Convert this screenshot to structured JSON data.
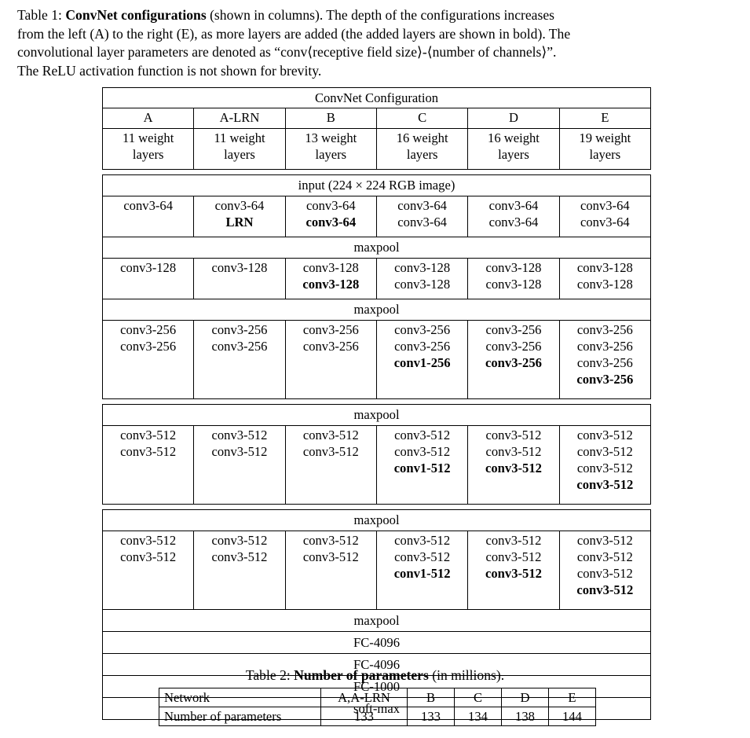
{
  "table1": {
    "caption_lines": [
      {
        "pre": "Table 1: ",
        "bold": "ConvNet configurations",
        "post": " (shown in columns).  The depth of the configurations increases"
      },
      {
        "pre": "",
        "bold": "",
        "post": "from the left (A) to the right (E), as more layers are added (the added layers are shown in bold). The"
      },
      {
        "pre": "",
        "bold": "",
        "post": "convolutional layer parameters are denoted as “conv⟨receptive field size⟩-⟨number of channels⟩”."
      },
      {
        "pre": "",
        "bold": "",
        "post": "The ReLU activation function is not shown for brevity."
      }
    ],
    "title_row": "ConvNet Configuration",
    "config_names": [
      "A",
      "A-LRN",
      "B",
      "C",
      "D",
      "E"
    ],
    "depths": [
      [
        "11 weight",
        "layers"
      ],
      [
        "11 weight",
        "layers"
      ],
      [
        "13 weight",
        "layers"
      ],
      [
        "16 weight",
        "layers"
      ],
      [
        "16 weight",
        "layers"
      ],
      [
        "19 weight",
        "layers"
      ]
    ],
    "input_row": "input (224 × 224 RGB image)",
    "maxpool": "maxpool",
    "block64": [
      [
        {
          "t": "conv3-64",
          "b": false
        }
      ],
      [
        {
          "t": "conv3-64",
          "b": false
        },
        {
          "t": "LRN",
          "b": true
        }
      ],
      [
        {
          "t": "conv3-64",
          "b": false
        },
        {
          "t": "conv3-64",
          "b": true
        }
      ],
      [
        {
          "t": "conv3-64",
          "b": false
        },
        {
          "t": "conv3-64",
          "b": false
        }
      ],
      [
        {
          "t": "conv3-64",
          "b": false
        },
        {
          "t": "conv3-64",
          "b": false
        }
      ],
      [
        {
          "t": "conv3-64",
          "b": false
        },
        {
          "t": "conv3-64",
          "b": false
        }
      ]
    ],
    "block128": [
      [
        {
          "t": "conv3-128",
          "b": false
        }
      ],
      [
        {
          "t": "conv3-128",
          "b": false
        }
      ],
      [
        {
          "t": "conv3-128",
          "b": false
        },
        {
          "t": "conv3-128",
          "b": true
        }
      ],
      [
        {
          "t": "conv3-128",
          "b": false
        },
        {
          "t": "conv3-128",
          "b": false
        }
      ],
      [
        {
          "t": "conv3-128",
          "b": false
        },
        {
          "t": "conv3-128",
          "b": false
        }
      ],
      [
        {
          "t": "conv3-128",
          "b": false
        },
        {
          "t": "conv3-128",
          "b": false
        }
      ]
    ],
    "block256": [
      [
        {
          "t": "conv3-256",
          "b": false
        },
        {
          "t": "conv3-256",
          "b": false
        }
      ],
      [
        {
          "t": "conv3-256",
          "b": false
        },
        {
          "t": "conv3-256",
          "b": false
        }
      ],
      [
        {
          "t": "conv3-256",
          "b": false
        },
        {
          "t": "conv3-256",
          "b": false
        }
      ],
      [
        {
          "t": "conv3-256",
          "b": false
        },
        {
          "t": "conv3-256",
          "b": false
        },
        {
          "t": "conv1-256",
          "b": true
        }
      ],
      [
        {
          "t": "conv3-256",
          "b": false
        },
        {
          "t": "conv3-256",
          "b": false
        },
        {
          "t": "conv3-256",
          "b": true
        }
      ],
      [
        {
          "t": "conv3-256",
          "b": false
        },
        {
          "t": "conv3-256",
          "b": false
        },
        {
          "t": "conv3-256",
          "b": false
        },
        {
          "t": "conv3-256",
          "b": true
        }
      ]
    ],
    "block512a": [
      [
        {
          "t": "conv3-512",
          "b": false
        },
        {
          "t": "conv3-512",
          "b": false
        }
      ],
      [
        {
          "t": "conv3-512",
          "b": false
        },
        {
          "t": "conv3-512",
          "b": false
        }
      ],
      [
        {
          "t": "conv3-512",
          "b": false
        },
        {
          "t": "conv3-512",
          "b": false
        }
      ],
      [
        {
          "t": "conv3-512",
          "b": false
        },
        {
          "t": "conv3-512",
          "b": false
        },
        {
          "t": "conv1-512",
          "b": true
        }
      ],
      [
        {
          "t": "conv3-512",
          "b": false
        },
        {
          "t": "conv3-512",
          "b": false
        },
        {
          "t": "conv3-512",
          "b": true
        }
      ],
      [
        {
          "t": "conv3-512",
          "b": false
        },
        {
          "t": "conv3-512",
          "b": false
        },
        {
          "t": "conv3-512",
          "b": false
        },
        {
          "t": "conv3-512",
          "b": true
        }
      ]
    ],
    "block512b": [
      [
        {
          "t": "conv3-512",
          "b": false
        },
        {
          "t": "conv3-512",
          "b": false
        }
      ],
      [
        {
          "t": "conv3-512",
          "b": false
        },
        {
          "t": "conv3-512",
          "b": false
        }
      ],
      [
        {
          "t": "conv3-512",
          "b": false
        },
        {
          "t": "conv3-512",
          "b": false
        }
      ],
      [
        {
          "t": "conv3-512",
          "b": false
        },
        {
          "t": "conv3-512",
          "b": false
        },
        {
          "t": "conv1-512",
          "b": true
        }
      ],
      [
        {
          "t": "conv3-512",
          "b": false
        },
        {
          "t": "conv3-512",
          "b": false
        },
        {
          "t": "conv3-512",
          "b": true
        }
      ],
      [
        {
          "t": "conv3-512",
          "b": false
        },
        {
          "t": "conv3-512",
          "b": false
        },
        {
          "t": "conv3-512",
          "b": false
        },
        {
          "t": "conv3-512",
          "b": true
        }
      ]
    ],
    "tail_rows": [
      "maxpool",
      "FC-4096",
      "FC-4096",
      "FC-1000",
      "soft-max"
    ]
  },
  "table2": {
    "caption": {
      "pre": "Table 2: ",
      "bold": "Number of parameters",
      "post": " (in millions)."
    },
    "header": [
      "Network",
      "A,A-LRN",
      "B",
      "C",
      "D",
      "E"
    ],
    "row": [
      "Number of parameters",
      "133",
      "133",
      "134",
      "138",
      "144"
    ]
  }
}
